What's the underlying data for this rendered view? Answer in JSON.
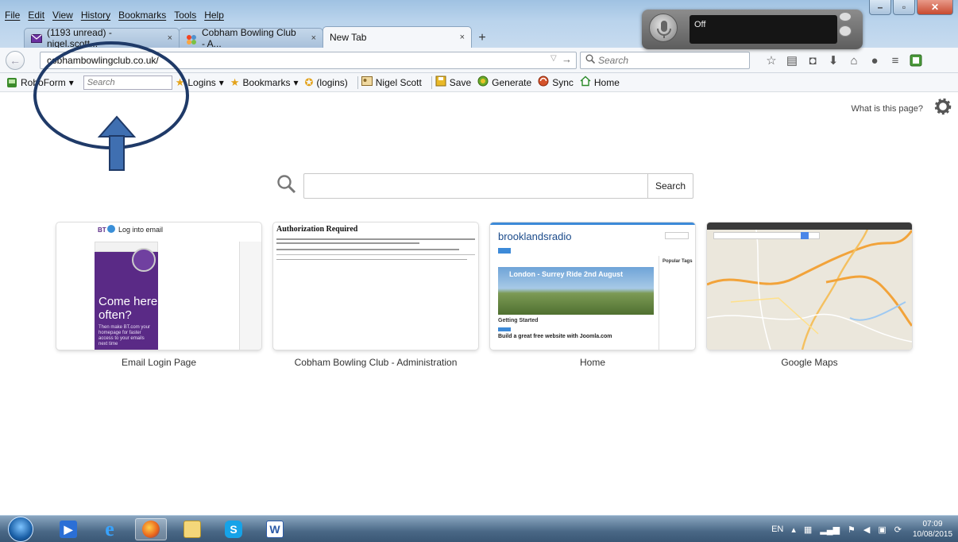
{
  "menu": [
    "File",
    "Edit",
    "View",
    "History",
    "Bookmarks",
    "Tools",
    "Help"
  ],
  "tabs": [
    {
      "label": "(1193 unread) - nigel.scott...",
      "close": "×"
    },
    {
      "label": "Cobham Bowling Club - A...",
      "close": "×"
    },
    {
      "label": "New Tab",
      "close": "×"
    }
  ],
  "newtab_symbol": "+",
  "address": {
    "value": "cobhambowlingclub.co.uk/"
  },
  "search": {
    "placeholder": "Search"
  },
  "bookmarks_bar": {
    "roboform": "RoboForm",
    "search_placeholder": "Search",
    "logins": "Logins",
    "bookmarks": "Bookmarks",
    "logins2": "(logins)",
    "identity": "Nigel Scott",
    "save": "Save",
    "generate": "Generate",
    "sync": "Sync",
    "home": "Home"
  },
  "newtab": {
    "what_is": "What is this page?",
    "search_button": "Search",
    "tiles": [
      {
        "label": "Email Login Page",
        "thumb_title": "Log into email",
        "thumb_big": "Come here often?",
        "thumb_small": "Then make BT.com your homepage for faster access to your emails next time"
      },
      {
        "label": "Cobham Bowling Club - Administration",
        "thumb_title": "Authorization Required"
      },
      {
        "label": "Home",
        "thumb_title": "brooklandsradio",
        "thumb_banner": "London - Surrey Ride 2nd August",
        "thumb_started": "Getting Started",
        "thumb_build": "Build a great free website with Joomla.com",
        "thumb_side": "Popular Tags"
      },
      {
        "label": "Google Maps"
      }
    ]
  },
  "speech_widget": {
    "status": "Off"
  },
  "taskbar": {
    "lang": "EN",
    "time": "07:09",
    "date": "10/08/2015"
  },
  "colors": {
    "annotation": "#1f3a68",
    "arrow_fill": "#3f6fb1",
    "purple": "#5a2a86"
  }
}
